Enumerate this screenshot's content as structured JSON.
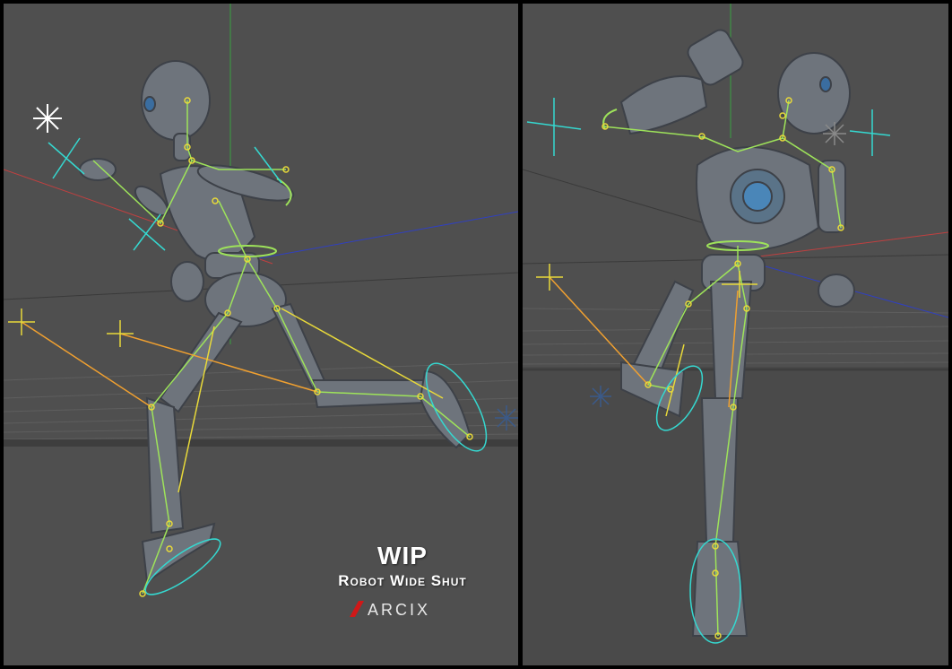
{
  "overlay": {
    "title": "WIP",
    "subtitle": "Robot Wide Shut",
    "logo_text": "ARCIX"
  },
  "colors": {
    "background": "#4f4f4f",
    "floor": "#4a4a4a",
    "robot": "#6e747c",
    "bone": "#9ee35a",
    "joint": "#e8d93a",
    "ik_line": "#f0a030",
    "control_cyan": "#35d8d0",
    "axis_x": "#c04040",
    "axis_y": "#3aa040",
    "axis_z": "#3040c0",
    "logo_red": "#d01818"
  },
  "viewports": [
    {
      "name": "left-viewport"
    },
    {
      "name": "right-viewport"
    }
  ]
}
